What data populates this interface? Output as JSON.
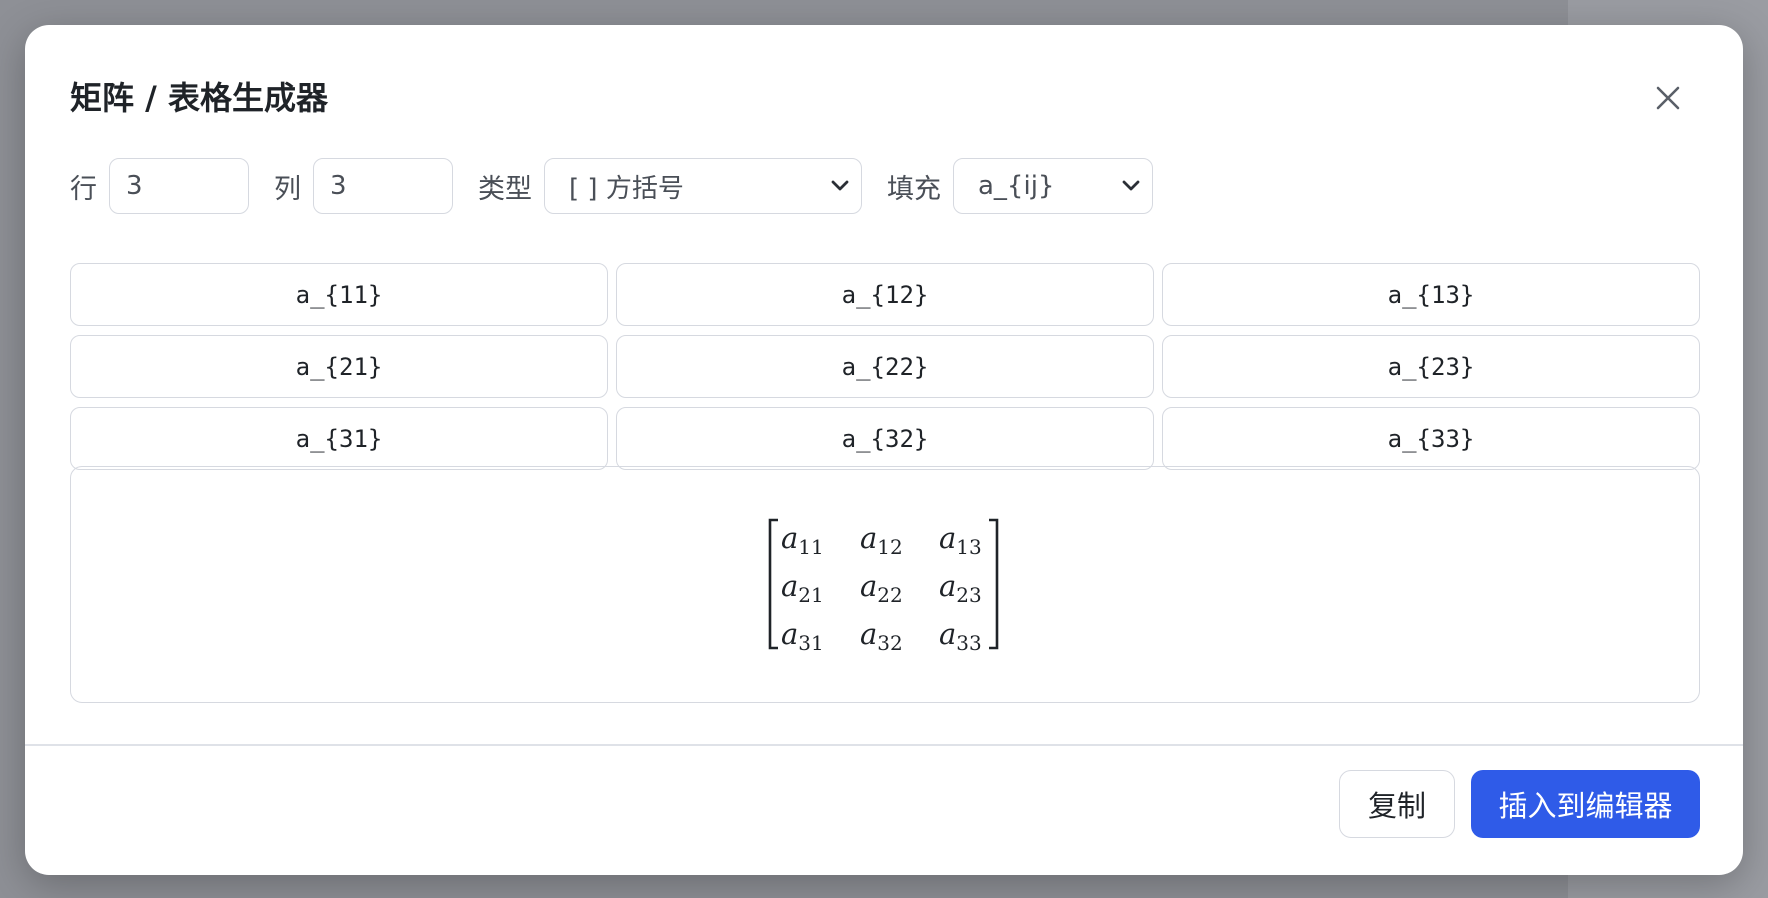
{
  "dialog": {
    "title": "矩阵 / 表格生成器",
    "rows_label": "行",
    "rows_value": "3",
    "cols_label": "列",
    "cols_value": "3",
    "type_label": "类型",
    "type_value": "[ ] 方括号",
    "fill_label": "填充",
    "fill_value": "a_{ij}"
  },
  "cells": [
    [
      "a_{11}",
      "a_{12}",
      "a_{13}"
    ],
    [
      "a_{21}",
      "a_{22}",
      "a_{23}"
    ],
    [
      "a_{31}",
      "a_{32}",
      "a_{33}"
    ]
  ],
  "preview": {
    "bracket": "square",
    "entries": [
      [
        {
          "base": "a",
          "sub": "11"
        },
        {
          "base": "a",
          "sub": "12"
        },
        {
          "base": "a",
          "sub": "13"
        }
      ],
      [
        {
          "base": "a",
          "sub": "21"
        },
        {
          "base": "a",
          "sub": "22"
        },
        {
          "base": "a",
          "sub": "23"
        }
      ],
      [
        {
          "base": "a",
          "sub": "31"
        },
        {
          "base": "a",
          "sub": "32"
        },
        {
          "base": "a",
          "sub": "33"
        }
      ]
    ]
  },
  "footer": {
    "copy_label": "复制",
    "insert_label": "插入到编辑器"
  },
  "colors": {
    "primary": "#2f5be8",
    "border": "#d6d9e0",
    "backdrop": "#8e9096"
  },
  "icons": {
    "close": "close-icon",
    "dropdown": "chevron-down-icon"
  }
}
